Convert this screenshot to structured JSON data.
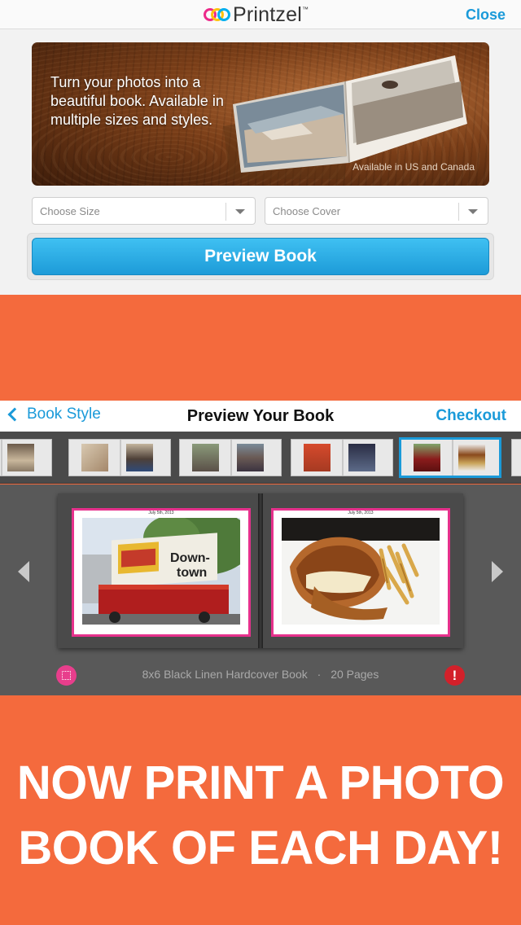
{
  "printzel": {
    "logo_text": "Printzel",
    "logo_tm": "™",
    "close_label": "Close",
    "hero_text": "Turn your photos into a beautiful book. Available in multiple sizes and styles.",
    "hero_note": "Available in US and Canada",
    "size_placeholder": "Choose Size",
    "cover_placeholder": "Choose Cover",
    "preview_button": "Preview Book"
  },
  "preview": {
    "back_label": "Book Style",
    "title": "Preview Your Book",
    "checkout_label": "Checkout",
    "page_date_left": "July 5th, 2013",
    "page_date_right": "July 5th, 2013",
    "book_description": "8x6 Black Linen Hardcover Book",
    "separator": "·",
    "page_count": "20 Pages",
    "warning_glyph": "!",
    "selected_thumbnail": 5
  },
  "headline": {
    "line1": "NOW PRINT A PHOTO",
    "line2": "BOOK OF EACH DAY!"
  },
  "colors": {
    "accent_blue": "#1a9ad9",
    "background_orange": "#f46a3d",
    "page_border_pink": "#e6318c",
    "warning_red": "#d3202a"
  }
}
